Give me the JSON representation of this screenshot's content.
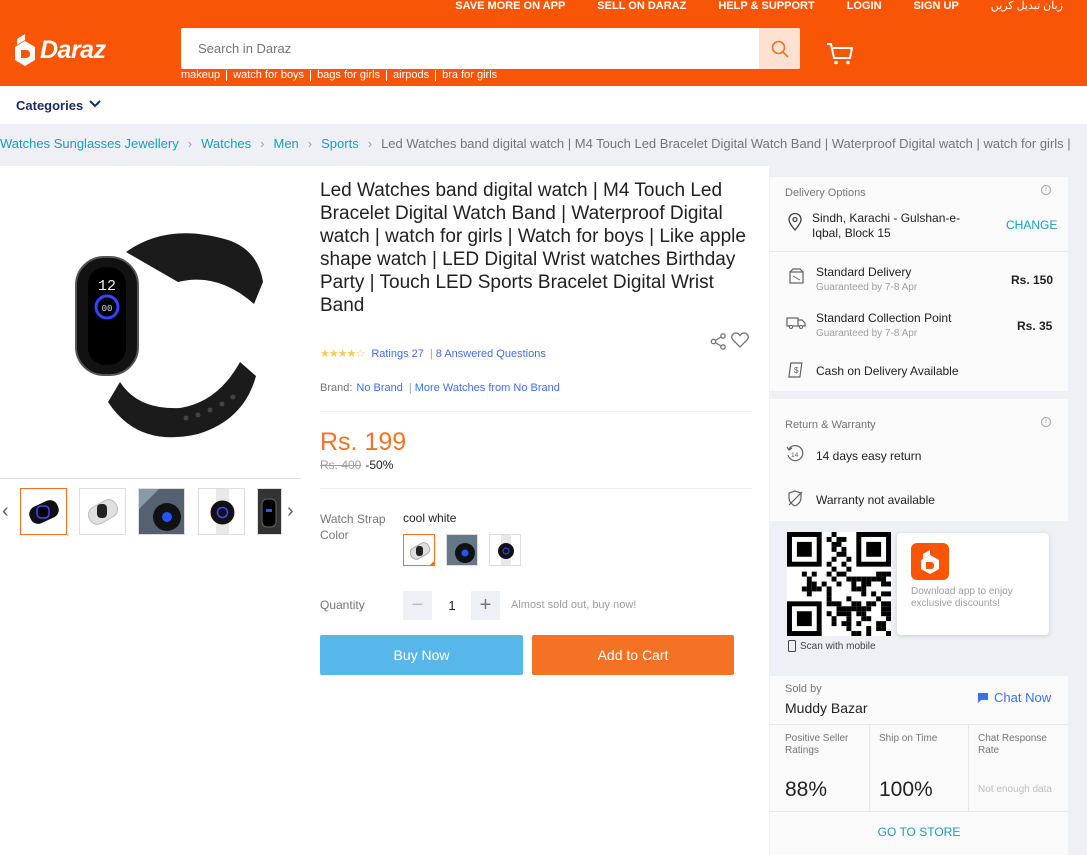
{
  "header": {
    "top_links": [
      "SAVE MORE ON APP",
      "SELL ON DARAZ",
      "HELP & SUPPORT",
      "LOGIN",
      "SIGN UP",
      "زبان تبدیل کریں"
    ],
    "logo_text": "Daraz",
    "search_placeholder": "Search in Daraz",
    "keywords": [
      "makeup",
      "watch for boys",
      "bags for girls",
      "airpods",
      "bra for girls"
    ],
    "brand_color": "#f85606"
  },
  "categories": {
    "label": "Categories"
  },
  "breadcrumb": {
    "items": [
      "Watches Sunglasses Jewellery",
      "Watches",
      "Men",
      "Sports"
    ],
    "current": "Led Watches band digital watch | M4 Touch Led Bracelet Digital Watch Band | Waterproof Digital watch | watch for girls |"
  },
  "product": {
    "title": "Led Watches band digital watch | M4 Touch Led Bracelet Digital Watch Band | Waterproof Digital watch | watch for girls | Watch for boys | Like apple shape watch | LED Digital Wrist watches Birthday Party | Touch LED Sports Bracelet Digital Wrist Band",
    "rating_stars": 4.5,
    "ratings_label": "Ratings 27",
    "answered_label": "8 Answered Questions",
    "brand_label": "Brand:",
    "brand_value": "No Brand",
    "more_from": "More Watches from No Brand",
    "price": "Rs. 199",
    "old_price": "Rs. 400",
    "discount": "-50%",
    "color_label": "Watch Strap Color",
    "color_value": "cool white",
    "quantity_label": "Quantity",
    "quantity_value": "1",
    "stock_note": "Almost sold out, buy now!",
    "buy_now": "Buy Now",
    "add_to_cart": "Add to Cart",
    "accent_color": "#f57224"
  },
  "delivery": {
    "title": "Delivery Options",
    "address": "Sindh, Karachi - Gulshan-e-Iqbal, Block 15",
    "change": "CHANGE",
    "options": [
      {
        "name": "Standard Delivery",
        "sub": "Guaranteed by 7-8 Apr",
        "price": "Rs. 150"
      },
      {
        "name": "Standard Collection Point",
        "sub": "Guaranteed by 7-8 Apr",
        "price": "Rs. 35"
      }
    ],
    "cod": "Cash on Delivery Available"
  },
  "warranty": {
    "title": "Return & Warranty",
    "return": "14 days easy return",
    "warranty": "Warranty not available"
  },
  "app": {
    "scan": "Scan with mobile",
    "promo": "Download app to enjoy exclusive discounts!"
  },
  "seller": {
    "sold_by": "Sold by",
    "name": "Muddy Bazar",
    "chat": "Chat Now",
    "metrics": [
      {
        "label": "Positive Seller Ratings",
        "value": "88%"
      },
      {
        "label": "Ship on Time",
        "value": "100%"
      },
      {
        "label": "Chat Response Rate",
        "value": "Not enough data"
      }
    ],
    "go_to_store": "GO TO STORE"
  }
}
